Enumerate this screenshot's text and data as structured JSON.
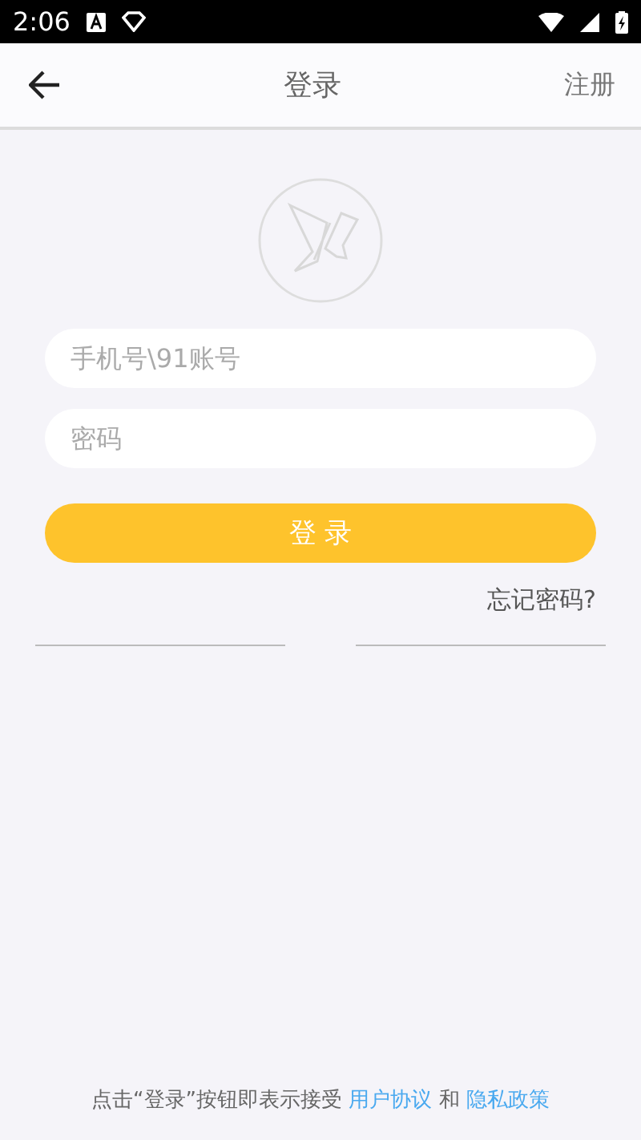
{
  "status_bar": {
    "time": "2:06"
  },
  "header": {
    "title": "登录",
    "action": "注册"
  },
  "form": {
    "account": {
      "placeholder": "手机号\\91账号"
    },
    "password": {
      "placeholder": "密码"
    },
    "submit": "登 录",
    "forgot": "忘记密码?"
  },
  "footer": [
    {
      "kind": "text",
      "text": "点击“登录”按钮即表示接受"
    },
    {
      "kind": "link",
      "text": "用户协议"
    },
    {
      "kind": "text",
      "text": "和"
    },
    {
      "kind": "link",
      "text": "隐私政策"
    }
  ]
}
